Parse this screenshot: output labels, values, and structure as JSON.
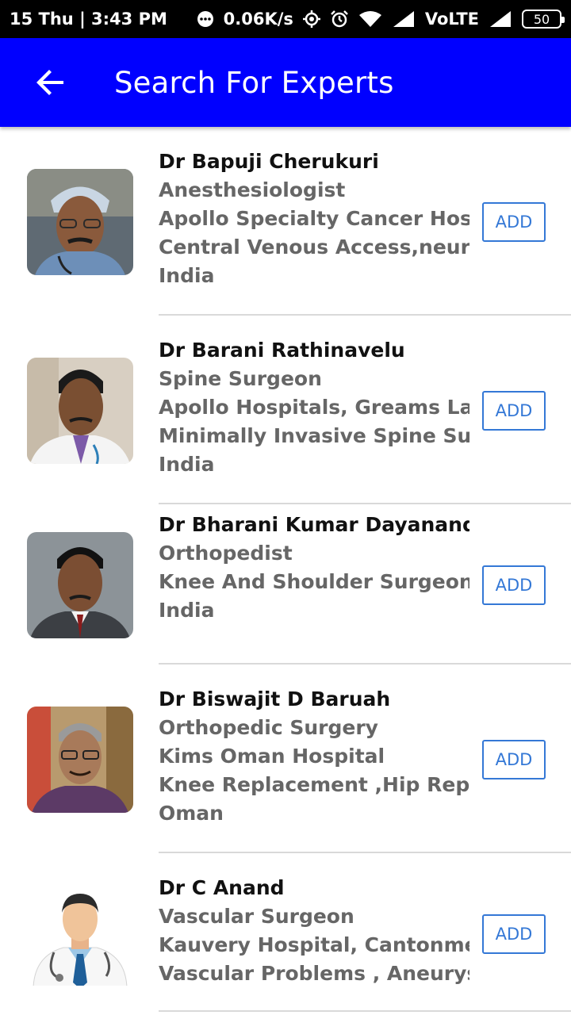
{
  "status_bar": {
    "time": "15 Thu | 3:43 PM",
    "network_speed": "0.06K/s",
    "carrier": "VoLTE",
    "battery": "50"
  },
  "app_bar": {
    "title": "Search For Experts",
    "background": "#0000ff"
  },
  "experts": [
    {
      "name": "Dr Bapuji Cherukuri",
      "specialty": "Anesthesiologist",
      "hospital": "Apollo Specialty Cancer Hospital",
      "focus": "Central Venous Access,neuroaxial",
      "country": "India",
      "add_label": "ADD"
    },
    {
      "name": "Dr Barani Rathinavelu",
      "specialty": "Spine Surgeon",
      "hospital": "Apollo Hospitals, Greams Lane",
      "focus": "Minimally Invasive Spine Surgery",
      "country": "India",
      "add_label": "ADD"
    },
    {
      "name": "Dr Bharani Kumar Dayanandam",
      "specialty": "Orthopedist",
      "hospital": "Knee And Shoulder Surgeon,",
      "country": "India",
      "add_label": "ADD"
    },
    {
      "name": "Dr Biswajit D Baruah",
      "specialty": "Orthopedic Surgery",
      "hospital": "Kims Oman Hospital",
      "focus": "Knee Replacement ,Hip Replacement",
      "country": "Oman",
      "add_label": "ADD"
    },
    {
      "name": "Dr C Anand",
      "specialty": "Vascular Surgeon",
      "hospital": "Kauvery Hospital, Cantonment,",
      "focus": "Vascular Problems , Aneurysms",
      "add_label": "ADD"
    }
  ]
}
